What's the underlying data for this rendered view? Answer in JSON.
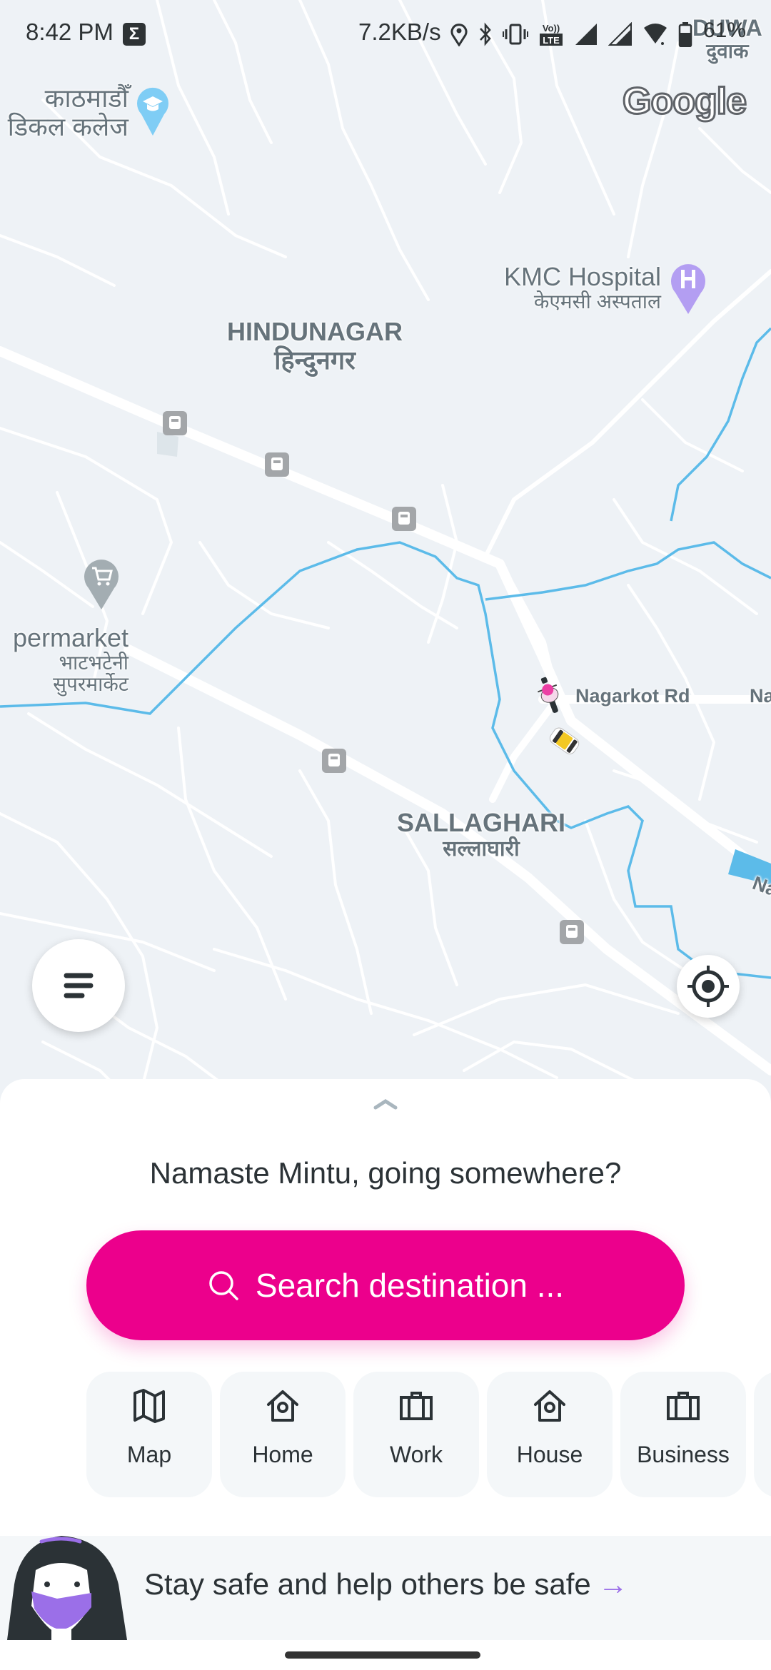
{
  "status_bar": {
    "time": "8:42 PM",
    "notification_icon": "sigma-icon",
    "net_speed": "7.2KB/s",
    "icons": [
      "location-icon",
      "bluetooth-icon",
      "vibrate-icon",
      "volte-icon",
      "signal-icon",
      "signal-icon",
      "wifi-icon",
      "battery-icon"
    ],
    "battery": "61%"
  },
  "map": {
    "attribution": "Google",
    "areas": [
      {
        "name": "HINDUNAGAR",
        "local": "हिन्दुनगर"
      },
      {
        "name": "SALLAGHARI",
        "local": "सल्लाघारी"
      },
      {
        "name": "DUWA",
        "local": "दुवाक"
      }
    ],
    "pois": [
      {
        "name": "",
        "local_line1": "काठमाडौँ",
        "local_line2": "डिकल कलेज",
        "icon": "graduation-cap-icon",
        "color": "#7fcdf5"
      },
      {
        "name": "KMC Hospital",
        "local": "केएमसी अस्पताल",
        "icon": "hospital-icon",
        "color": "#b39ef2"
      },
      {
        "name": "permarket",
        "local_line1": "भाटभटेनी",
        "local_line2": "सुपरमार्केट",
        "icon": "shopping-cart-icon",
        "color": "#a3adb2"
      }
    ],
    "roads": [
      "Nagarkot Rd",
      "Na",
      "Na"
    ],
    "vehicles": [
      "bike-rider-icon",
      "taxi-car-icon"
    ]
  },
  "controls": {
    "menu_icon": "menu-icon",
    "locate_icon": "my-location-icon"
  },
  "sheet": {
    "greeting": "Namaste Mintu, going somewhere?",
    "search_label": "Search destination ...",
    "search_color": "#ec008c",
    "places": [
      {
        "label": "Map",
        "icon": "map-icon"
      },
      {
        "label": "Home",
        "icon": "home-icon"
      },
      {
        "label": "Work",
        "icon": "briefcase-icon"
      },
      {
        "label": "House",
        "icon": "home-icon"
      },
      {
        "label": "Business",
        "icon": "briefcase-icon"
      }
    ],
    "banner": {
      "text": "Stay safe and help others be safe",
      "arrow": "→",
      "accent": "#9b6fe8"
    }
  }
}
